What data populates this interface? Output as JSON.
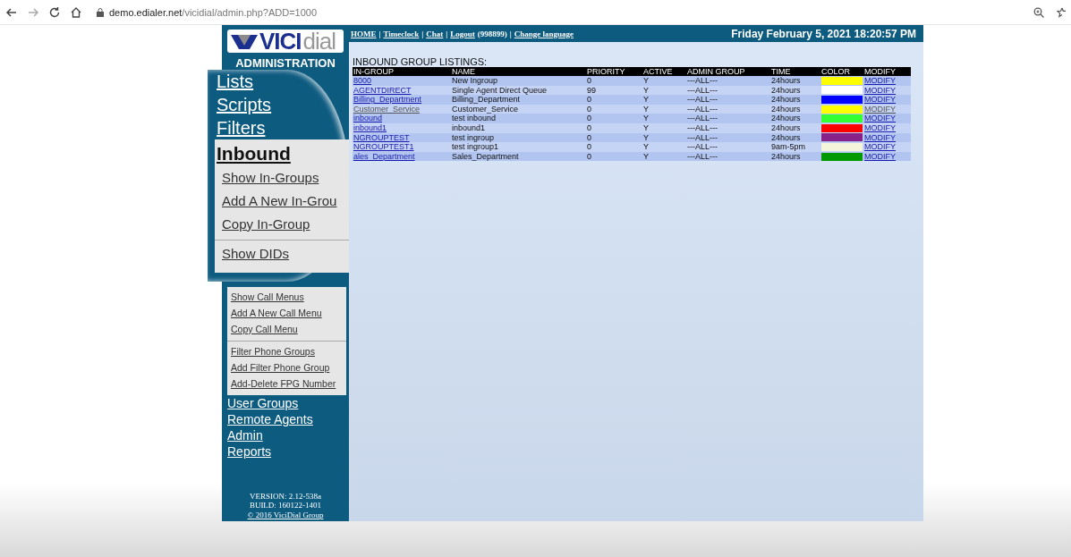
{
  "browser": {
    "url_host": "demo.edialer.net",
    "url_path": "/vicidial/admin.php?ADD=1000"
  },
  "sidebar": {
    "logo": {
      "part_a": "VICI",
      "part_b": "dial"
    },
    "subtitle": "ADMINISTRATION",
    "magnified_links": [
      {
        "label": "Lists"
      },
      {
        "label": "Scripts"
      },
      {
        "label": "Filters"
      }
    ],
    "inbound": {
      "title": "Inbound",
      "groups": [
        {
          "magnified": true,
          "items": [
            {
              "label": "Show In-Groups"
            },
            {
              "label": "Add A New In-Grou"
            },
            {
              "label": "Copy In-Group"
            }
          ]
        },
        {
          "magnified": true,
          "items": [
            {
              "label": "Show DIDs"
            }
          ]
        },
        {
          "magnified": false,
          "items": [
            {
              "label": "Show Call Menus"
            },
            {
              "label": "Add A New Call Menu"
            },
            {
              "label": "Copy Call Menu"
            }
          ]
        },
        {
          "magnified": false,
          "items": [
            {
              "label": "Filter Phone Groups"
            },
            {
              "label": "Add Filter Phone Group"
            },
            {
              "label": "Add-Delete FPG Number"
            }
          ]
        }
      ]
    },
    "links": [
      {
        "label": "User Groups"
      },
      {
        "label": "Remote Agents"
      },
      {
        "label": "Admin"
      },
      {
        "label": "Reports"
      }
    ],
    "footer": {
      "version": "VERSION: 2.12-538a",
      "build": "BUILD: 160122-1401",
      "copyright": "© 2016 ViciDial Group"
    }
  },
  "top_nav": {
    "separator": "|",
    "links": [
      {
        "label": "HOME"
      },
      {
        "label": "Timeclock"
      },
      {
        "label": "Chat"
      },
      {
        "label": "Logout",
        "suffix": "(998899)"
      },
      {
        "label": "Change language"
      }
    ],
    "date": "Friday February 5, 2021 18:20:57 PM"
  },
  "listing": {
    "title": "INBOUND GROUP LISTINGS:",
    "columns": [
      "IN-GROUP",
      "NAME",
      "PRIORITY",
      "ACTIVE",
      "ADMIN GROUP",
      "TIME",
      "COLOR",
      "MODIFY"
    ],
    "rows": [
      {
        "in_group": "8000",
        "name": "New Ingroup",
        "priority": "0",
        "active": "Y",
        "admin_group": "---ALL---",
        "time": "24hours",
        "color": "#ffff00",
        "modify": "MODIFY",
        "visited": false
      },
      {
        "in_group": "AGENTDIRECT",
        "name": "Single Agent Direct Queue",
        "priority": "99",
        "active": "Y",
        "admin_group": "---ALL---",
        "time": "24hours",
        "color": "#ffffff",
        "modify": "MODIFY",
        "visited": false
      },
      {
        "in_group": "Billing_Department",
        "name": "Billing_Department",
        "priority": "0",
        "active": "Y",
        "admin_group": "---ALL---",
        "time": "24hours",
        "color": "#0000ff",
        "modify": "MODIFY",
        "visited": false
      },
      {
        "in_group": "Customer_Service",
        "name": "Customer_Service",
        "priority": "0",
        "active": "Y",
        "admin_group": "---ALL---",
        "time": "24hours",
        "color": "#ffff00",
        "modify": "MODIFY",
        "visited": true
      },
      {
        "in_group": "inbound",
        "name": "test inbound",
        "priority": "0",
        "active": "Y",
        "admin_group": "---ALL---",
        "time": "24hours",
        "color": "#33ff33",
        "modify": "MODIFY",
        "visited": false
      },
      {
        "in_group": "inbound1",
        "name": "inbound1",
        "priority": "0",
        "active": "Y",
        "admin_group": "---ALL---",
        "time": "24hours",
        "color": "#ff0000",
        "modify": "MODIFY",
        "visited": false
      },
      {
        "in_group": "NGROUPTEST",
        "name": "test ingroup",
        "priority": "0",
        "active": "Y",
        "admin_group": "---ALL---",
        "time": "24hours",
        "color": "#882288",
        "modify": "MODIFY",
        "visited": false
      },
      {
        "in_group": "NGROUPTEST1",
        "name": "test ingroup1",
        "priority": "0",
        "active": "Y",
        "admin_group": "---ALL---",
        "time": "9am-5pm",
        "color": "#f5f5dc",
        "modify": "MODIFY",
        "visited": false
      },
      {
        "in_group": "ales_Department",
        "name": "Sales_Department",
        "priority": "0",
        "active": "Y",
        "admin_group": "---ALL---",
        "time": "24hours",
        "color": "#009900",
        "modify": "MODIFY",
        "visited": false
      }
    ]
  }
}
